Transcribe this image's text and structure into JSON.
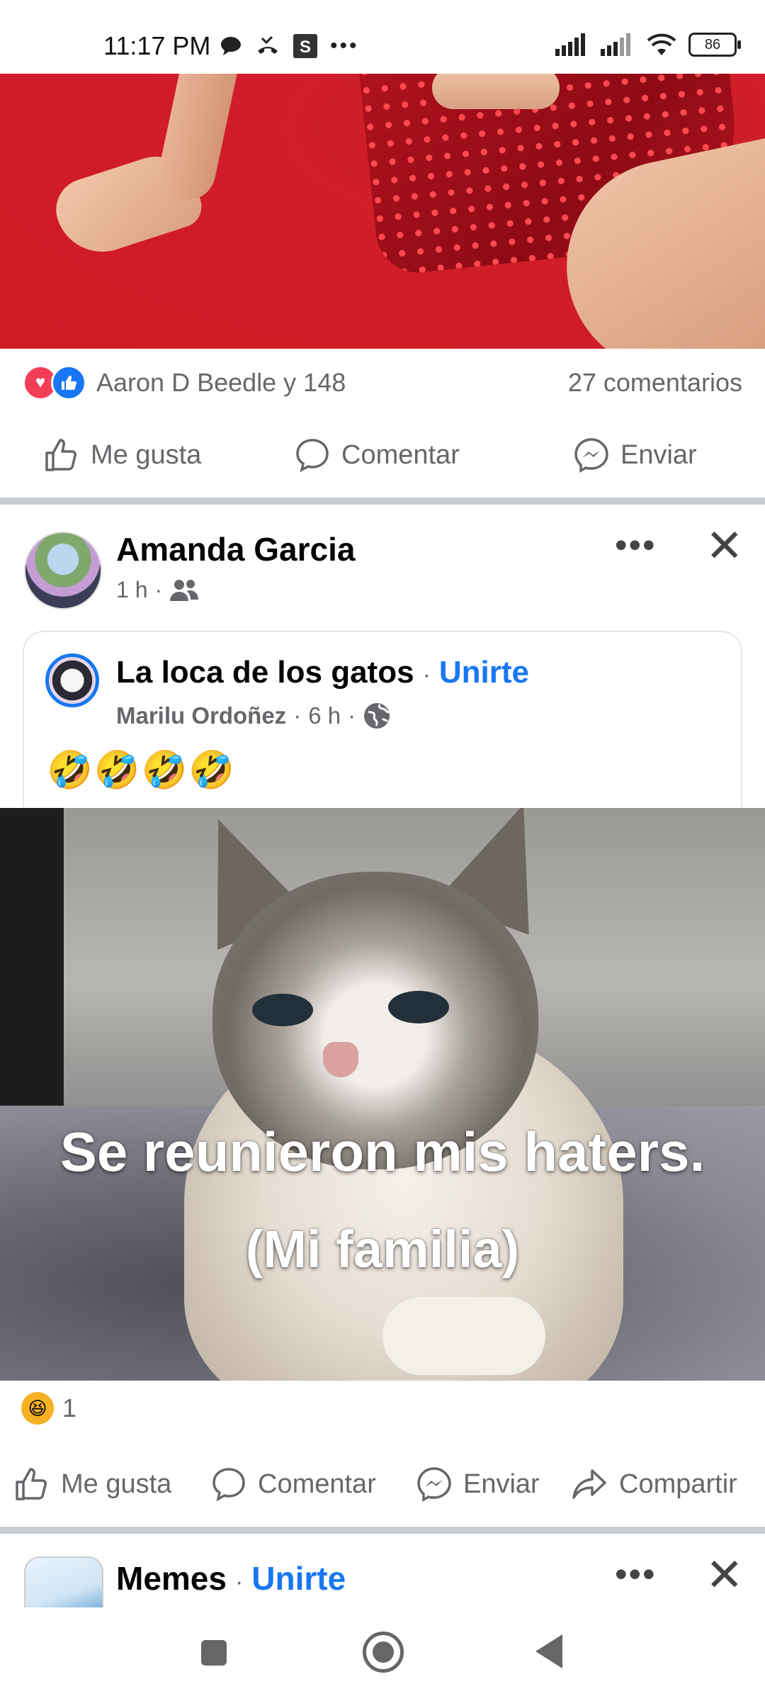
{
  "status_bar": {
    "time": "11:17 PM",
    "battery": "86",
    "icons": [
      "chat-bubble-icon",
      "missed-call-icon",
      "s-app-icon",
      "more-icon",
      "signal-icon",
      "signal-icon",
      "wifi-icon",
      "battery-icon"
    ]
  },
  "post1": {
    "reactions": {
      "names": "Aaron D Beedle y 148",
      "comments": "27 comentarios",
      "icons": [
        "love-reaction-icon",
        "like-reaction-icon"
      ]
    },
    "actions": {
      "like": "Me gusta",
      "comment": "Comentar",
      "send": "Enviar"
    }
  },
  "post2": {
    "author": "Amanda Garcia",
    "time": "1 h",
    "audience_icon": "friends-icon",
    "shared": {
      "group": "La loca de los gatos",
      "join": "Unirte",
      "author": "Marilu Ordoñez",
      "time": "6 h",
      "audience_icon": "globe-icon",
      "text": "🤣🤣🤣🤣"
    },
    "meme_text": {
      "line1": "Se reunieron mis haters.",
      "line2": "(Mi familia)"
    },
    "reactions": {
      "count": "1",
      "icon": "haha-reaction-icon"
    },
    "actions": {
      "like": "Me gusta",
      "comment": "Comentar",
      "send": "Enviar",
      "share": "Compartir"
    }
  },
  "post3": {
    "group": "Memes",
    "join": "Unirte"
  },
  "colors": {
    "accent": "#1877f2",
    "secondary_text": "#65676b",
    "divider": "#c9ccd1",
    "love": "#f33e58"
  }
}
